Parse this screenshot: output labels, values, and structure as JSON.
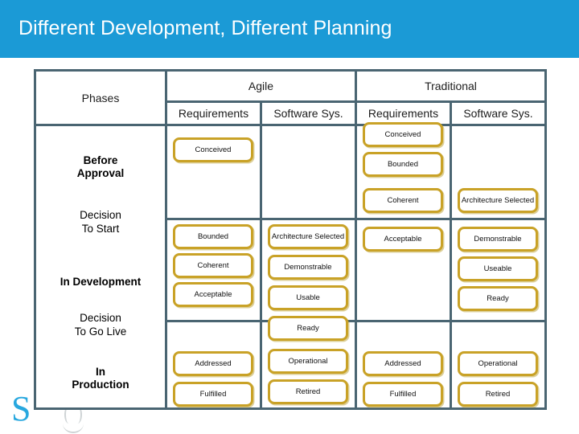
{
  "slide": {
    "title": "Different Development, Different Planning",
    "title_bar_color": "#1B9AD6",
    "table_border_color": "#4A6572",
    "box_border_color": "#C9A227",
    "logo_letter": "S"
  },
  "table": {
    "corner_header": "Phases",
    "groups": [
      {
        "label": "Agile"
      },
      {
        "label": "Traditional"
      }
    ],
    "subheaders": [
      "Requirements",
      "Software Sys.",
      "Requirements",
      "Software Sys."
    ],
    "phases": [
      {
        "label_line1": "Before",
        "label_line2": "Approval"
      },
      {
        "label_line1": "In Development",
        "label_line2": ""
      },
      {
        "label_line1": "In",
        "label_line2": "Production"
      }
    ],
    "gates": [
      {
        "line1": "Decision",
        "line2": "To Start"
      },
      {
        "line1": "Decision",
        "line2": "To Go Live"
      }
    ],
    "cells": {
      "agile_requirements": {
        "before_approval": [
          "Conceived"
        ],
        "in_development": [
          "Bounded",
          "Coherent",
          "Acceptable"
        ],
        "in_production": [
          "Addressed",
          "Fulfilled"
        ]
      },
      "agile_software_sys": {
        "before_approval": [],
        "in_development": [
          "Architecture Selected",
          "Demonstrable",
          "Usable",
          "Ready"
        ],
        "in_production": [
          "Operational",
          "Retired"
        ]
      },
      "traditional_requirements": {
        "before_approval": [
          "Conceived",
          "Bounded",
          "Coherent"
        ],
        "in_development": [
          "Acceptable"
        ],
        "in_production": [
          "Addressed",
          "Fulfilled"
        ]
      },
      "traditional_software_sys": {
        "before_approval": [
          "Architecture Selected"
        ],
        "in_development": [
          "Demonstrable",
          "Useable",
          "Ready"
        ],
        "in_production": [
          "Operational",
          "Retired"
        ]
      }
    }
  }
}
